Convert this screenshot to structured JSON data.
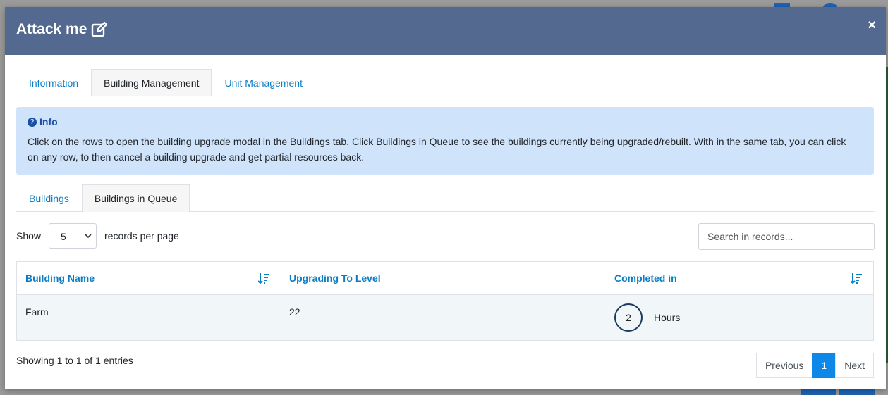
{
  "modal": {
    "title": "Attack me",
    "close_label": "×"
  },
  "tabs": [
    "Information",
    "Building Management",
    "Unit Management"
  ],
  "active_tab": 1,
  "info": {
    "heading": "Info",
    "text": "Click on the rows to open the building upgrade modal in the Buildings tab. Click Buildings in Queue to see the buildings currently being upgraded/rebuilt. With in the same tab, you can click on any row, to then cancel a building upgrade and get partial resources back."
  },
  "sub_tabs": [
    "Buildings",
    "Buildings in Queue"
  ],
  "active_sub_tab": 1,
  "records": {
    "show_label": "Show",
    "per_page_value": "5",
    "per_page_label": "records per page",
    "search_placeholder": "Search in records..."
  },
  "table": {
    "columns": [
      "Building Name",
      "Upgrading To Level",
      "Completed in"
    ],
    "rows": [
      {
        "building": "Farm",
        "level": "22",
        "completed_value": "2",
        "completed_unit": "Hours"
      }
    ]
  },
  "footer": {
    "showing": "Showing 1 to 1 of 1 entries",
    "previous": "Previous",
    "page": "1",
    "next": "Next"
  },
  "colors": {
    "header_bg": "#53698f",
    "link_blue": "#0b7dc4",
    "info_bg": "#cfe3fb",
    "active_page": "#0d87e8"
  }
}
